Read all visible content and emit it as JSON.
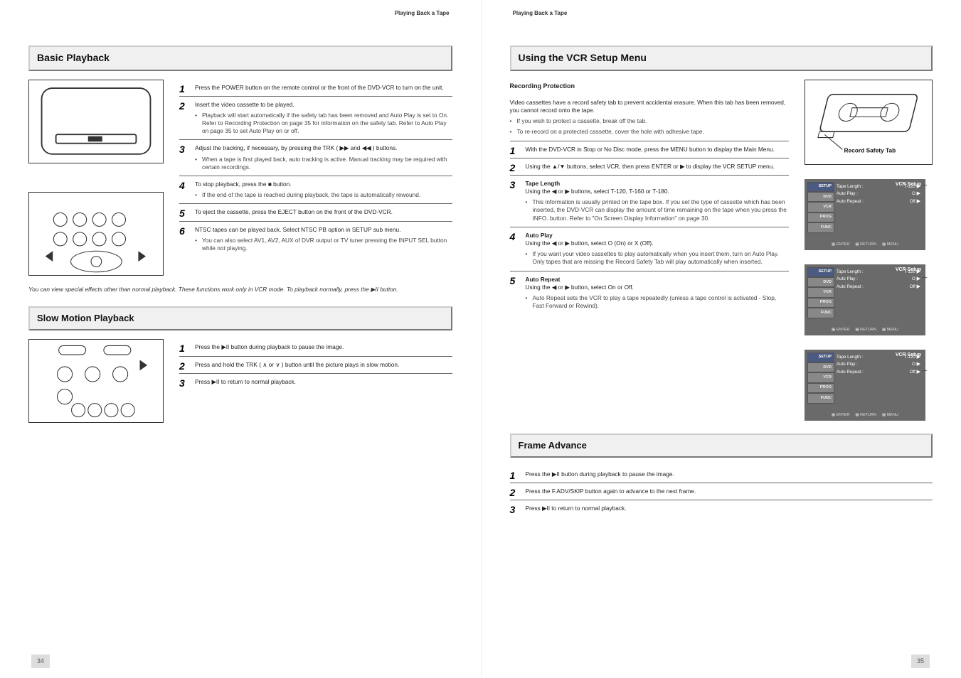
{
  "pageLeft": {
    "sectionLabel": "Playing Back a Tape",
    "headings": {
      "main": "Basic Playback",
      "sub": "Slow Motion Playback"
    },
    "intro": "You can view special effects other than normal playback. These functions work only in VCR mode. To playback normally, press the ▶II button.",
    "steps": [
      {
        "num": "1",
        "text": "Press the POWER button on the remote control or the front of the DVD-VCR to turn on the unit."
      },
      {
        "num": "2",
        "text": "Insert the video cassette to be played.",
        "note": "Playback will start automatically if the safety tab has been removed and Auto Play is set to On. Refer to Recording Protection on page 35 for information on the safety tab. Refer to Auto Play on page 35 to set Auto Play on or off."
      },
      {
        "num": "3",
        "text": "Adjust the tracking, if necessary, by pressing the TRK ( ▶▶ and ◀◀ ) buttons.",
        "note": "When a tape is first played back, auto tracking is active. Manual tracking may be required with certain recordings."
      },
      {
        "num": "4",
        "text": "To stop playback, press the ■ button.",
        "note": "If the end of the tape is reached during playback, the tape is automatically rewound."
      },
      {
        "num": "5",
        "text": "To eject the cassette, press the EJECT button on the front of the DVD-VCR."
      },
      {
        "num": "6",
        "text": "NTSC tapes can be played back. Select NTSC PB option in SETUP sub menu."
      },
      {
        "num": "•",
        "text": "You can also select AV1, AV2, AUX of DVR output or TV tuner pressing the INPUT SEL button while not playing."
      }
    ],
    "slowSteps": [
      {
        "num": "1",
        "text": "Press the ▶II button during playback to pause the image."
      },
      {
        "num": "2",
        "text": "Press and hold the TRK ( ∧  or  ∨ ) button until the picture plays in slow motion."
      },
      {
        "num": "3",
        "text": "Press ▶II to return to normal playback."
      }
    ],
    "pageNum": "34"
  },
  "pageRight": {
    "sectionLabel": "Playing Back a Tape",
    "headings": {
      "main": "Using the VCR Setup Menu"
    },
    "intro1": "Recording Protection",
    "protection": [
      "Video cassettes have a record safety tab to prevent accidental erasure. When this tab has been removed, you cannot record onto the tape.",
      "If you wish to protect a cassette, break off the tab.",
      "To re-record on a protected cassette, cover the hole with adhesive tape."
    ],
    "steps": [
      {
        "num": "1",
        "text": "With the DVD-VCR in Stop or No Disc mode, press the MENU button to display the Main Menu."
      },
      {
        "num": "2",
        "text": "Using the ▲/▼ buttons, select VCR, then press ENTER or ▶ to display the VCR SETUP menu."
      },
      {
        "num": "3",
        "label": "Tape Length",
        "text": "Using the ◀ or ▶ buttons, select T-120, T-160 or T-180.",
        "note": "This information is usually printed on the tape box. If you set the type of cassette which has been inserted, the DVD-VCR can display the amount of time remaining on the tape when you press the INFO. button. Refer to \"On Screen Display Information\" on page 30."
      },
      {
        "num": "4",
        "label": "Auto Play",
        "text": "Using the ◀ or ▶ button, select O (On) or X (Off).",
        "note": "If you want your video cassettes to play automatically when you insert them, turn on Auto Play. Only tapes that are missing the Record Safety Tab will play automatically when inserted."
      },
      {
        "num": "5",
        "label": "Auto Repeat",
        "text": "Using the ◀ or ▶ button, select On or Off.",
        "note": "Auto Repeat sets the VCR to play a tape repeatedly (unless a tape control is activated - Stop, Fast Forward or Rewind)."
      }
    ],
    "frameSteps": [
      {
        "num": "1",
        "text": "Press the ▶II button during playback to pause the image."
      },
      {
        "num": "2",
        "text": "Press the F.ADV/SKIP button again to advance to the next frame."
      },
      {
        "num": "3",
        "text": "Press ▶II to return to normal playback."
      }
    ],
    "subHeading": "Frame Advance",
    "menu": {
      "title": "VCR Setup",
      "tabs": [
        "SETUP",
        "DVD",
        "VCR",
        "PROG",
        "FUNC"
      ],
      "items": [
        {
          "label": "Tape Length :",
          "val": "T-120"
        },
        {
          "label": "Auto Play :",
          "val": "O"
        },
        {
          "label": "Auto Repeat :",
          "val": "Off"
        }
      ],
      "legend": [
        "ENTER",
        "RETURN",
        "MENU"
      ]
    },
    "cassetteLabel": "Record Safety Tab",
    "pageNum": "35"
  }
}
